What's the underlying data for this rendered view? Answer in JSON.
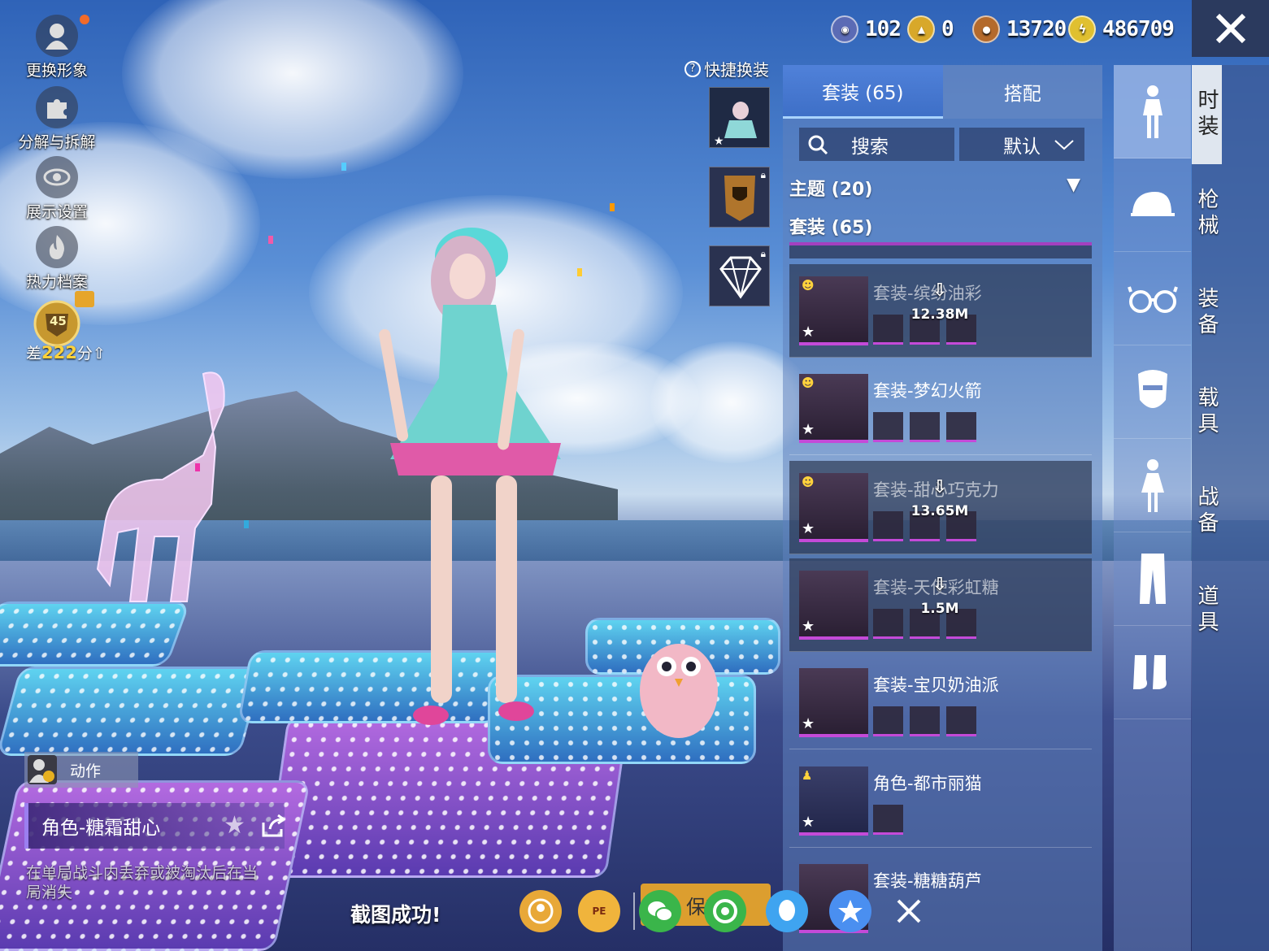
{
  "left_menu": [
    {
      "label": "更换形象",
      "icon": "avatar-icon"
    },
    {
      "label": "分解与拆解",
      "icon": "puzzle-icon"
    },
    {
      "label": "展示设置",
      "icon": "eye-icon"
    },
    {
      "label": "热力档案",
      "icon": "flame-icon"
    }
  ],
  "rank": {
    "level": "45",
    "diff_prefix": "差",
    "diff_value": "222",
    "diff_suffix": "分"
  },
  "currencies": [
    {
      "icon": "token-icon",
      "value": "102",
      "color": "#5b6bb5"
    },
    {
      "icon": "badge-coin-icon",
      "value": "0",
      "color": "#d8a82a"
    },
    {
      "icon": "bronze-coin-icon",
      "value": "13720",
      "color": "#b46a2c"
    },
    {
      "icon": "lightning-coin-icon",
      "value": "486709",
      "color": "#e0c030"
    }
  ],
  "quick_change": {
    "label": "快捷换装"
  },
  "panel": {
    "tabs": [
      {
        "label": "套装 (65)",
        "active": true
      },
      {
        "label": "搭配",
        "active": false
      }
    ],
    "search_label": "搜索",
    "sort_label": "默认",
    "theme_label": "主题 (20)",
    "suits_label": "套装 (65)",
    "items": [
      {
        "name": "套装-缤纷油彩",
        "download": "12.38M",
        "dim": true,
        "subs": 3
      },
      {
        "name": "套装-梦幻火箭",
        "download": "",
        "dim": false,
        "subs": 3
      },
      {
        "name": "套装-甜心巧克力",
        "download": "13.65M",
        "dim": true,
        "subs": 3
      },
      {
        "name": "套装-天使彩虹糖",
        "download": "1.5M",
        "dim": true,
        "subs": 3
      },
      {
        "name": "套装-宝贝奶油派",
        "download": "",
        "dim": false,
        "subs": 3
      },
      {
        "name": "角色-都市丽猫",
        "download": "",
        "dim": false,
        "subs": 1
      },
      {
        "name": "套装-糖糖葫芦",
        "download": "",
        "dim": false,
        "subs": 0
      }
    ]
  },
  "categories": [
    "outfit-icon",
    "cap-icon",
    "glasses-icon",
    "mask-icon",
    "dress-icon",
    "pants-icon",
    "shoes-icon"
  ],
  "vertical_tabs": [
    {
      "label": "时装",
      "active": true
    },
    {
      "label": "枪械",
      "active": false
    },
    {
      "label": "装备",
      "active": false
    },
    {
      "label": "载具",
      "active": false
    },
    {
      "label": "战备",
      "active": false
    },
    {
      "label": "道具",
      "active": false
    }
  ],
  "bottom": {
    "action_label": "动作",
    "role_label": "角色-糖霜甜心",
    "hint": "在单局战斗内丢弃或被淘汰后在当局消失",
    "screenshot_label": "截图成功!",
    "save_label": "保存"
  },
  "share_icons": [
    "gamecenter-icon",
    "peace-elite-icon",
    "wechat-icon",
    "moments-icon",
    "qq-icon",
    "qzone-icon",
    "close-icon"
  ],
  "brand_colors": {
    "purple": "#c44ad8",
    "panel": "#5f82be"
  }
}
